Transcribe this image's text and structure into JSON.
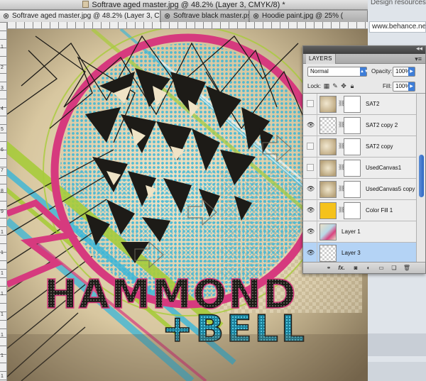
{
  "window": {
    "title": "Softrave aged master.jpg @ 48.2% (Layer 3, CMYK/8) *"
  },
  "tabs": [
    {
      "label": "Softrave aged master.jpg @ 48.2% (Layer 3, CMYK/8) *",
      "active": true
    },
    {
      "label": "Softrave black master.psd",
      "active": false
    },
    {
      "label": "Hoodie paint.jpg @ 25% (",
      "active": false
    }
  ],
  "ruler": {
    "left_numbers": [
      "1",
      "2",
      "3",
      "4",
      "5",
      "6",
      "7",
      "8",
      "9",
      "1",
      "1",
      "1",
      "1",
      "1",
      "1",
      "1",
      "1"
    ]
  },
  "artwork": {
    "title_line1": "HAMMOND",
    "title_line2": "+BELL",
    "colors": {
      "background": "#d8c7a0",
      "pink": "#d63a7e",
      "cyan": "#39b6d9",
      "green": "#a8cc3b",
      "dark": "#1d1b17",
      "cream": "#efe3c6"
    }
  },
  "browser": {
    "heading": "Design resources",
    "url": "www.behance.ne"
  },
  "layers_panel": {
    "tab_label": "LAYERS",
    "blend_mode": "Normal",
    "opacity_label": "Opacity:",
    "opacity_value": "100%",
    "lock_label": "Lock:",
    "fill_label": "Fill:",
    "fill_value": "100%",
    "layers": [
      {
        "name": "SAT2",
        "visible": false,
        "thumb": "sat",
        "has_mask": true,
        "selected": false
      },
      {
        "name": "SAT2 copy 2",
        "visible": true,
        "thumb": "check",
        "has_mask": true,
        "selected": false
      },
      {
        "name": "SAT2 copy",
        "visible": false,
        "thumb": "sat",
        "has_mask": true,
        "selected": false
      },
      {
        "name": "UsedCanvas1",
        "visible": false,
        "thumb": "used",
        "has_mask": true,
        "selected": false
      },
      {
        "name": "UsedCanvas5 copy",
        "visible": true,
        "thumb": "used",
        "has_mask": true,
        "selected": false
      },
      {
        "name": "Color Fill 1",
        "visible": true,
        "thumb": "gold",
        "has_mask": true,
        "selected": false
      },
      {
        "name": "Layer 1",
        "visible": true,
        "thumb": "layer1",
        "has_mask": false,
        "selected": false
      },
      {
        "name": "Layer 3",
        "visible": true,
        "thumb": "check",
        "has_mask": false,
        "selected": true
      }
    ],
    "footer_icons": [
      "link-icon",
      "fx-icon",
      "mask-icon",
      "adjustment-icon",
      "folder-icon",
      "new-layer-icon",
      "trash-icon"
    ],
    "footer_fx": "fx."
  }
}
